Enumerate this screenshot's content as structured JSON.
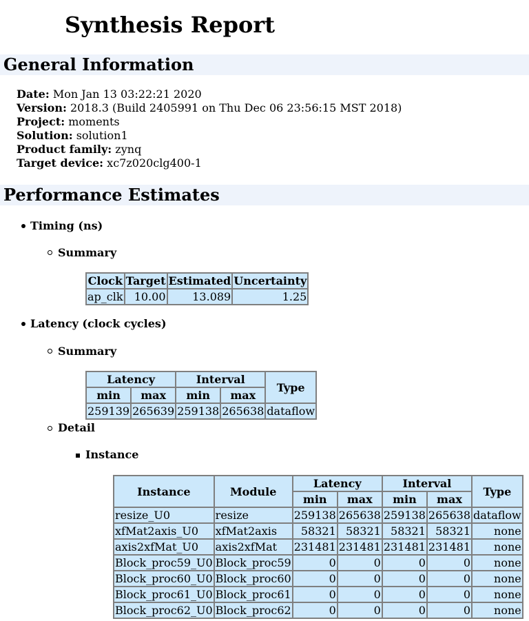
{
  "page": {
    "title": "Synthesis Report"
  },
  "general": {
    "heading": "General Information",
    "rows": [
      {
        "label": "Date:",
        "value": "Mon Jan 13 03:22:21 2020"
      },
      {
        "label": "Version:",
        "value": "2018.3 (Build 2405991 on Thu Dec 06 23:56:15 MST 2018)"
      },
      {
        "label": "Project:",
        "value": "moments"
      },
      {
        "label": "Solution:",
        "value": "solution1"
      },
      {
        "label": "Product family:",
        "value": "zynq"
      },
      {
        "label": "Target device:",
        "value": "xc7z020clg400-1"
      }
    ]
  },
  "performance": {
    "heading": "Performance Estimates",
    "timing": {
      "label": "Timing (ns)",
      "summary_label": "Summary",
      "headers": [
        "Clock",
        "Target",
        "Estimated",
        "Uncertainty"
      ],
      "row": [
        "ap_clk",
        "10.00",
        "13.089",
        "1.25"
      ]
    },
    "latency": {
      "label": "Latency (clock cycles)",
      "summary_label": "Summary",
      "group_headers": {
        "latency": "Latency",
        "interval": "Interval",
        "type": "Type"
      },
      "sub_headers": {
        "min1": "min",
        "max1": "max",
        "min2": "min",
        "max2": "max"
      },
      "row": [
        "259139",
        "265639",
        "259138",
        "265638",
        "dataflow"
      ],
      "detail_label": "Detail",
      "instance_label": "Instance",
      "instance_table": {
        "headers": {
          "instance": "Instance",
          "module": "Module",
          "latency": "Latency",
          "interval": "Interval",
          "type": "Type",
          "min1": "min",
          "max1": "max",
          "min2": "min",
          "max2": "max"
        },
        "rows": [
          [
            "resize_U0",
            "resize",
            "259138",
            "265638",
            "259138",
            "265638",
            "dataflow"
          ],
          [
            "xfMat2axis_U0",
            "xfMat2axis",
            "58321",
            "58321",
            "58321",
            "58321",
            "none"
          ],
          [
            "axis2xfMat_U0",
            "axis2xfMat",
            "231481",
            "231481",
            "231481",
            "231481",
            "none"
          ],
          [
            "Block_proc59_U0",
            "Block_proc59",
            "0",
            "0",
            "0",
            "0",
            "none"
          ],
          [
            "Block_proc60_U0",
            "Block_proc60",
            "0",
            "0",
            "0",
            "0",
            "none"
          ],
          [
            "Block_proc61_U0",
            "Block_proc61",
            "0",
            "0",
            "0",
            "0",
            "none"
          ],
          [
            "Block_proc62_U0",
            "Block_proc62",
            "0",
            "0",
            "0",
            "0",
            "none"
          ]
        ]
      }
    }
  }
}
